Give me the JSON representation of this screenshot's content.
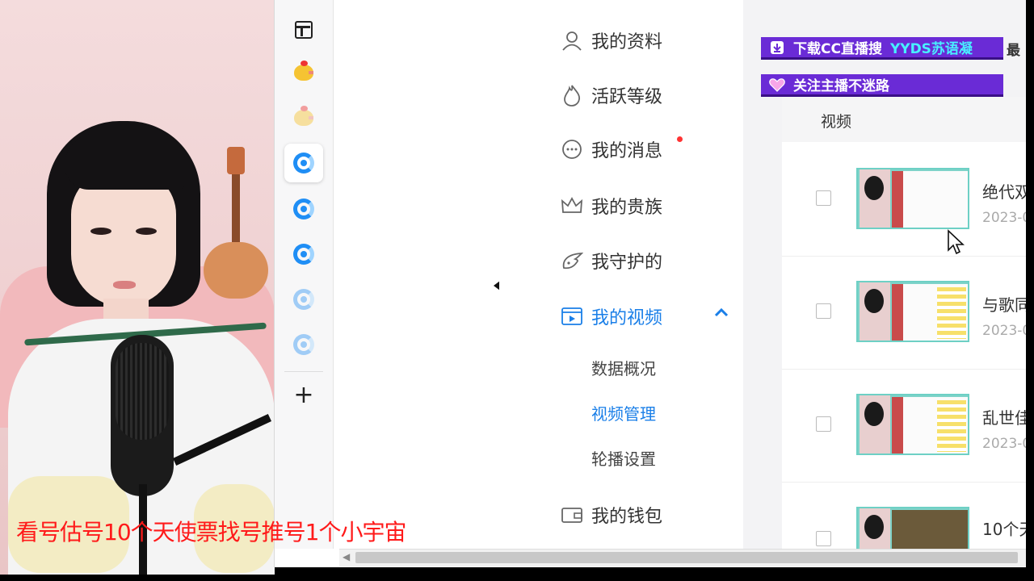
{
  "overlay": {
    "caption": "看号估号10个天使票找号推号1个小宇宙",
    "banner_download_prefix": "下载CC直播搜",
    "banner_download_highlight": "YYDS苏语凝",
    "banner_download_tail": "最",
    "banner_follow": "关注主播不迷路"
  },
  "menu": {
    "items": [
      {
        "label": "我的资料",
        "icon": "person-icon"
      },
      {
        "label": "活跃等级",
        "icon": "flame-icon"
      },
      {
        "label": "我的消息",
        "icon": "chat-icon"
      },
      {
        "label": "我的贵族",
        "icon": "crown-icon"
      },
      {
        "label": "我守护的",
        "icon": "wing-icon"
      },
      {
        "label": "我的视频",
        "icon": "video-icon"
      }
    ],
    "sub_items": [
      {
        "label": "数据概况"
      },
      {
        "label": "视频管理"
      },
      {
        "label": "轮播设置"
      }
    ],
    "wallet": {
      "label": "我的钱包",
      "icon": "wallet-icon"
    }
  },
  "content": {
    "column_header": "视频",
    "rows": [
      {
        "title": "绝代双",
        "date": "2023-0"
      },
      {
        "title": "与歌同",
        "date": "2023-0"
      },
      {
        "title": "乱世佳",
        "date": "2023-0"
      },
      {
        "title": "10个天",
        "date": ""
      }
    ]
  },
  "colors": {
    "accent": "#1a7fe8",
    "banner": "#6a2bd6",
    "caption": "#ff1a1a"
  }
}
